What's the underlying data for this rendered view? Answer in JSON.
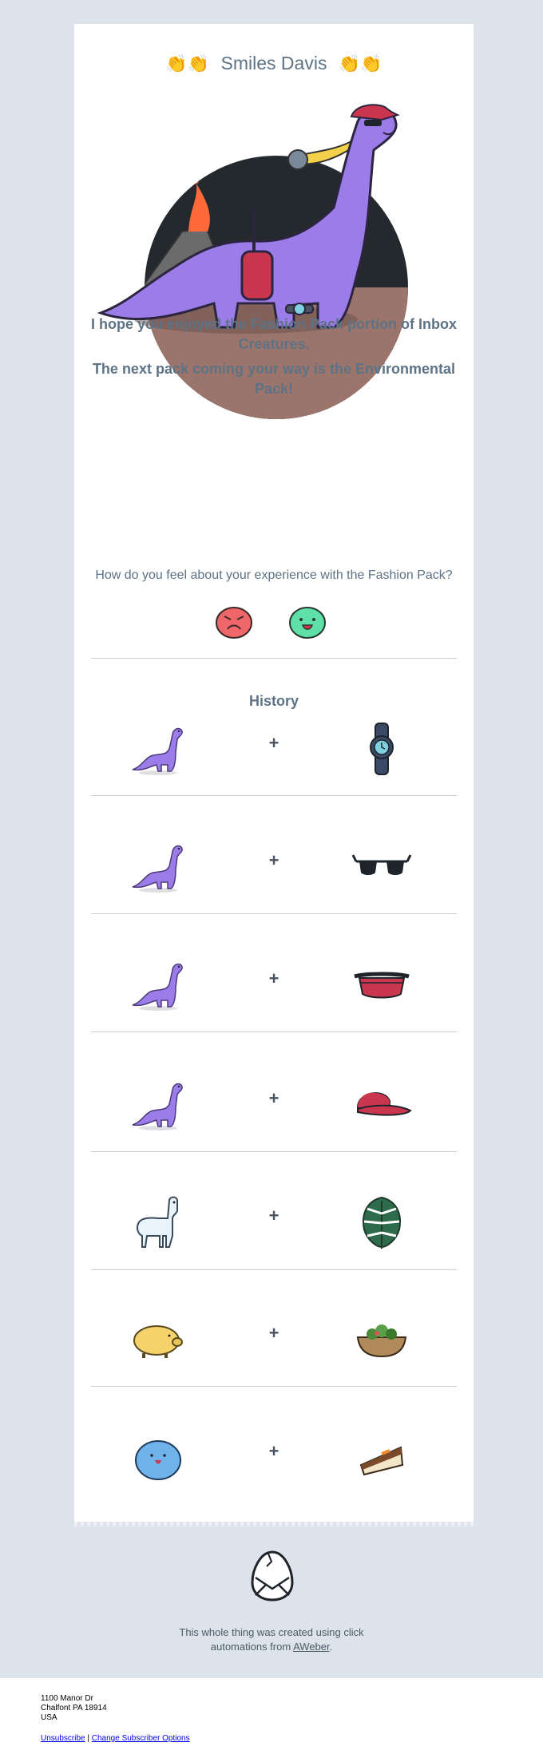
{
  "greeting": {
    "clap_left": "👏👏",
    "name": "Smiles Davis",
    "clap_right": "👏👏"
  },
  "hero": {
    "icon": "dinosaur-fashion-illustration"
  },
  "message": {
    "line1": "I hope you enjoyed the Fashion Pack portion of Inbox Creatures.",
    "line2": "The next pack coming your way is the Environmental Pack!",
    "question": "How do you feel about your experience with the Fashion Pack?"
  },
  "rating": {
    "negative_icon": "angry-face-icon",
    "positive_icon": "happy-face-icon"
  },
  "history": {
    "title": "History",
    "plus": "+",
    "rows": [
      {
        "creature": "purple-dinosaur",
        "item": "wristwatch"
      },
      {
        "creature": "purple-dinosaur",
        "item": "sunglasses"
      },
      {
        "creature": "purple-dinosaur",
        "item": "fanny-pack"
      },
      {
        "creature": "purple-dinosaur",
        "item": "baseball-cap"
      },
      {
        "creature": "llama",
        "item": "monstera-leaf"
      },
      {
        "creature": "pig",
        "item": "salad-bowl"
      },
      {
        "creature": "blue-blob",
        "item": "carrot-cake-slice"
      }
    ]
  },
  "credit": {
    "text": "This whole thing was created using click automations from",
    "link": "AWeber",
    "end": "."
  },
  "footer": {
    "address_line1": "1100 Manor Dr",
    "address_line2": "Chalfont PA 18914",
    "address_line3": "USA",
    "unsubscribe": "Unsubscribe",
    "separator": "|",
    "change_options": "Change Subscriber Options"
  },
  "colors": {
    "page_bg": "#dce3ea",
    "text": "#5d7385",
    "dino_purple": "#9b7ce8",
    "accent_red": "#c9364e",
    "smile_green": "#5ee0a8",
    "frown_red": "#f0676b"
  }
}
